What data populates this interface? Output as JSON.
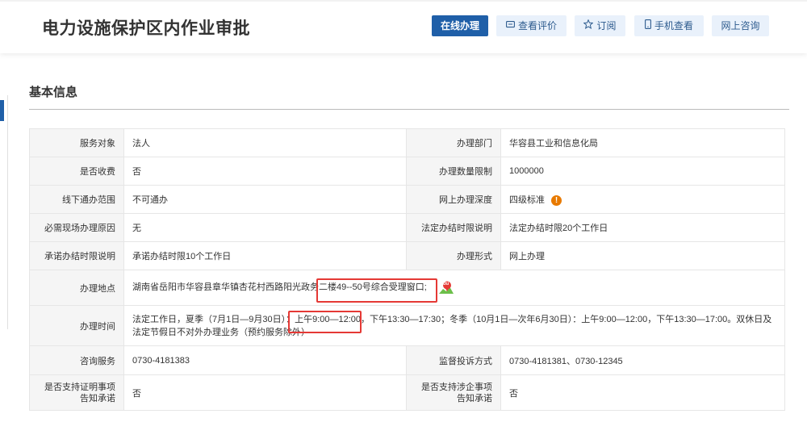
{
  "header": {
    "title": "电力设施保护区内作业审批",
    "buttons": {
      "online": "在线办理",
      "review": "查看评价",
      "subscribe": "订阅",
      "mobile": "手机查看",
      "consult": "网上咨询"
    },
    "icons": {
      "review": "comment-icon",
      "subscribe": "star-icon",
      "mobile": "mobile-icon"
    }
  },
  "section": {
    "title": "基本信息"
  },
  "info": {
    "service_target": {
      "label": "服务对象",
      "value": "法人"
    },
    "department": {
      "label": "办理部门",
      "value": "华容县工业和信息化局"
    },
    "charge": {
      "label": "是否收费",
      "value": "否"
    },
    "quantity_limit": {
      "label": "办理数量限制",
      "value": "1000000"
    },
    "offline_scope": {
      "label": "线下通办范围",
      "value": "不可通办"
    },
    "online_depth": {
      "label": "网上办理深度",
      "value": "四级标准",
      "badge": "!"
    },
    "onsite_reason": {
      "label": "必需现场办理原因",
      "value": "无"
    },
    "legal_limit": {
      "label": "法定办结时限说明",
      "value": "法定办结时限20个工作日"
    },
    "promised_limit": {
      "label": "承诺办结时限说明",
      "value": "承诺办结时限10个工作日"
    },
    "form": {
      "label": "办理形式",
      "value": "网上办理"
    },
    "location": {
      "label": "办理地点",
      "value": "湖南省岳阳市华容县章华镇杏花村西路阳光政务二楼49--50号综合受理窗口;",
      "map_badge": "du"
    },
    "hours": {
      "label": "办理时间",
      "value": "法定工作日，夏季（7月1日—9月30日）：上午9:00—12:00，下午13:30—17:30；冬季（10月1日—次年6月30日）：上午9:00—12:00，下午13:30—17:00。双休日及法定节假日不对外办理业务（预约服务除外）"
    },
    "consult_phone": {
      "label": "咨询服务",
      "value": "0730-4181383"
    },
    "complaint": {
      "label": "监督投诉方式",
      "value": "0730-4181381、0730-12345"
    },
    "cert_promise": {
      "label": "是否支持证明事项告知承诺",
      "value": "否"
    },
    "enterprise_promise": {
      "label": "是否支持涉企事项告知承诺",
      "value": "否"
    }
  },
  "colors": {
    "primary": "#1f5fa8",
    "button_bg": "#e9f1fb",
    "highlight": "#e53935",
    "warning": "#e87a00"
  }
}
